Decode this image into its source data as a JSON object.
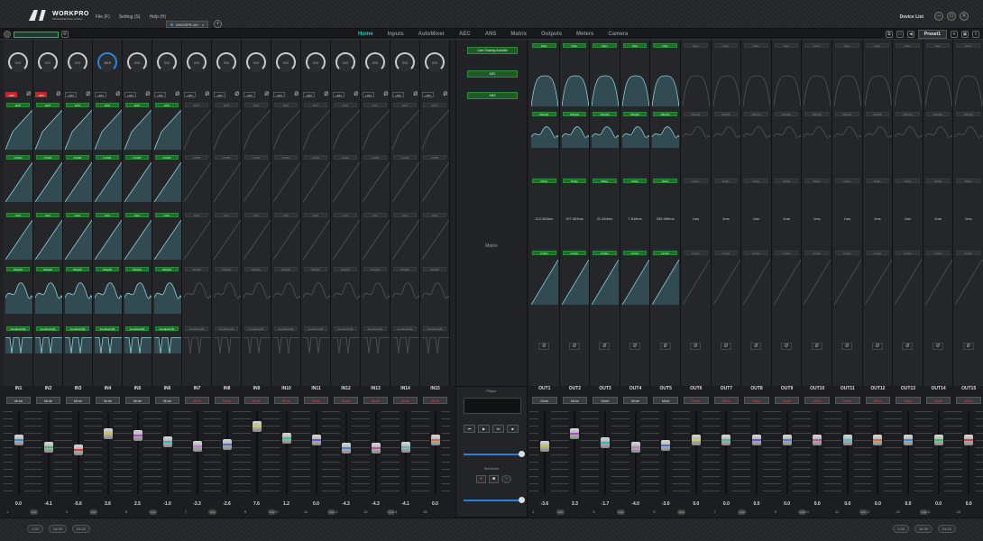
{
  "app": {
    "logo": "WORKPRO",
    "logo_sub": "PROFESSIONAL AUDIO",
    "menus": [
      "File (F)",
      "Setting (S)",
      "Help (H)"
    ],
    "device_tab": "WKDSPR-16+",
    "device_list": "Device List"
  },
  "toolbar": {
    "tabs": [
      "Home",
      "Inputs",
      "AutoMixer",
      "AEC",
      "ANS",
      "Matrix",
      "Outputs",
      "Meters",
      "Camera"
    ],
    "active_tab": "Home",
    "preset": "Preset1"
  },
  "inputs": [
    {
      "name": "IN1",
      "knob": "0.0",
      "p48": true,
      "gain": "0.0",
      "num": "1",
      "mute": "Mute"
    },
    {
      "name": "IN2",
      "knob": "0.0",
      "p48": true,
      "gain": "-4.1",
      "num": "2",
      "mute": "Mute"
    },
    {
      "name": "IN3",
      "knob": "0.0",
      "p48": false,
      "gain": "-5.6",
      "num": "3",
      "mute": "Mute"
    },
    {
      "name": "IN4",
      "knob": "15.0",
      "p48": false,
      "gain": "3.6",
      "num": "4",
      "mute": "Mute"
    },
    {
      "name": "IN5",
      "knob": "0.0",
      "p48": false,
      "gain": "2.5",
      "num": "5",
      "mute": "Mute"
    },
    {
      "name": "IN6",
      "knob": "0.0",
      "p48": false,
      "gain": "-1.0",
      "num": "6",
      "mute": "Mute"
    },
    {
      "name": "IN7",
      "knob": "0.0",
      "p48": false,
      "gain": "-3.3",
      "num": "7",
      "mute": "Mute"
    },
    {
      "name": "IN8",
      "knob": "0.0",
      "p48": false,
      "gain": "-2.6",
      "num": "8",
      "mute": "Mute"
    },
    {
      "name": "IN9",
      "knob": "0.0",
      "p48": false,
      "gain": "7.6",
      "num": "9",
      "mute": "Mute"
    },
    {
      "name": "IN10",
      "knob": "0.0",
      "p48": false,
      "gain": "1.2",
      "num": "10",
      "mute": "Mute"
    },
    {
      "name": "IN11",
      "knob": "0.0",
      "p48": false,
      "gain": "0.0",
      "num": "11",
      "mute": "Mute"
    },
    {
      "name": "IN12",
      "knob": "0.0",
      "p48": false,
      "gain": "-4.3",
      "num": "12",
      "mute": "Mute"
    },
    {
      "name": "IN13",
      "knob": "0.0",
      "p48": false,
      "gain": "-4.3",
      "num": "13",
      "mute": "Mute"
    },
    {
      "name": "IN14",
      "knob": "0.0",
      "p48": false,
      "gain": "-4.1",
      "num": "14",
      "mute": "Mute"
    },
    {
      "name": "IN15",
      "knob": "0.0",
      "p48": false,
      "gain": "0.0",
      "num": "15",
      "mute": "Mute"
    }
  ],
  "modules_in": {
    "p48_label": "+48V",
    "gate": "EXP",
    "comp": "COMP",
    "agc": "AGC",
    "peq": "PEQ(8)",
    "fb": "Feedback(8)"
  },
  "center": {
    "cam_btn": "Cam Sharing AutoMix",
    "aec_btn": "AEC",
    "ans_btn": "ANS",
    "matrix": "Matrix",
    "player": "Player",
    "recorder": "Recorder"
  },
  "outputs": [
    {
      "name": "OUT1",
      "delay": "212.083ms",
      "active": true,
      "gain": "-3.6",
      "num": "1",
      "mute": "Mute"
    },
    {
      "name": "OUT2",
      "delay": "107.063ms",
      "active": true,
      "gain": "3.3",
      "num": "2",
      "mute": "Mute"
    },
    {
      "name": "OUT3",
      "delay": "21.454ms",
      "active": true,
      "gain": "-1.7",
      "num": "3",
      "mute": "Mute"
    },
    {
      "name": "OUT4",
      "delay": "7.818ms",
      "active": true,
      "gain": "-4.0",
      "num": "4",
      "mute": "Mute"
    },
    {
      "name": "OUT5",
      "delay": "335.089ms",
      "active": true,
      "gain": "-3.0",
      "num": "5",
      "mute": "Mute"
    },
    {
      "name": "OUT6",
      "delay": "1ms",
      "active": false,
      "gain": "0.0",
      "num": "6",
      "mute": "Mute"
    },
    {
      "name": "OUT7",
      "delay": "1ms",
      "active": false,
      "gain": "0.0",
      "num": "7",
      "mute": "Mute"
    },
    {
      "name": "OUT8",
      "delay": "1ms",
      "active": false,
      "gain": "0.0",
      "num": "8",
      "mute": "Mute"
    },
    {
      "name": "OUT9",
      "delay": "1ms",
      "active": false,
      "gain": "0.0",
      "num": "9",
      "mute": "Mute"
    },
    {
      "name": "OUT10",
      "delay": "1ms",
      "active": false,
      "gain": "0.0",
      "num": "10",
      "mute": "Mute"
    },
    {
      "name": "OUT11",
      "delay": "1ms",
      "active": false,
      "gain": "0.0",
      "num": "11",
      "mute": "Mute"
    },
    {
      "name": "OUT12",
      "delay": "1ms",
      "active": false,
      "gain": "0.0",
      "num": "12",
      "mute": "Mute"
    },
    {
      "name": "OUT13",
      "delay": "1ms",
      "active": false,
      "gain": "0.0",
      "num": "13",
      "mute": "Mute"
    },
    {
      "name": "OUT14",
      "delay": "1ms",
      "active": false,
      "gain": "0.0",
      "num": "14",
      "mute": "Mute"
    },
    {
      "name": "OUT15",
      "delay": "1ms",
      "active": false,
      "gain": "0.0",
      "num": "15",
      "mute": "Mute"
    }
  ],
  "modules_out": {
    "filter": "Filter",
    "peq": "PEQ(8)",
    "delay": "Delay",
    "limiter": "Limiter",
    "link": "Link"
  },
  "status": {
    "left": [
      "1:33",
      "16:39",
      "01:32"
    ],
    "right": [
      "1:33",
      "16:39",
      "01:32"
    ]
  },
  "colors": {
    "accent": "#27c4c8",
    "active_module": "#1f6b2a",
    "mute_red": "#e23b3b",
    "p48_red": "#c0262a"
  }
}
